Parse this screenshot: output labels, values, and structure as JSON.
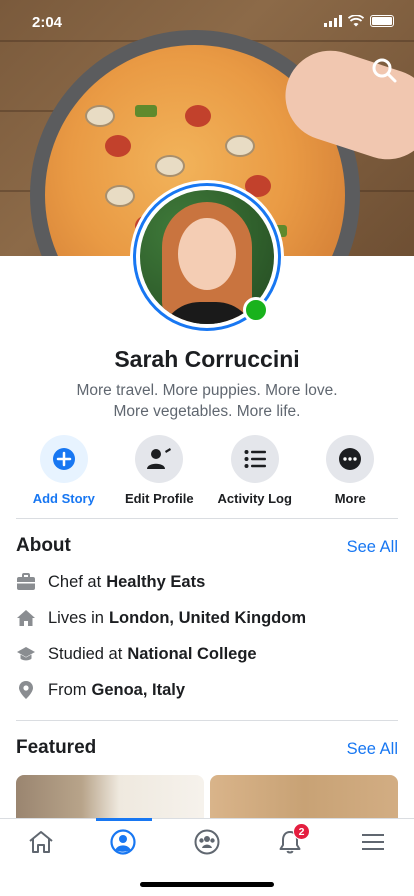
{
  "status_bar": {
    "time": "2:04"
  },
  "profile": {
    "name": "Sarah Corruccini",
    "bio_line1": "More travel. More puppies. More love.",
    "bio_line2": "More vegetables. More life."
  },
  "actions": [
    {
      "label": "Add Story",
      "icon": "plus-circle-icon"
    },
    {
      "label": "Edit Profile",
      "icon": "edit-profile-icon"
    },
    {
      "label": "Activity Log",
      "icon": "list-icon"
    },
    {
      "label": "More",
      "icon": "more-icon"
    }
  ],
  "about": {
    "title": "About",
    "see_all": "See All",
    "items": [
      {
        "prefix": "Chef at",
        "value": "Healthy Eats",
        "icon": "briefcase-icon"
      },
      {
        "prefix": "Lives in",
        "value": "London, United Kingdom",
        "icon": "home-icon"
      },
      {
        "prefix": "Studied at",
        "value": "National College",
        "icon": "graduation-cap-icon"
      },
      {
        "prefix": "From",
        "value": "Genoa, Italy",
        "icon": "location-pin-icon"
      }
    ]
  },
  "featured": {
    "title": "Featured",
    "see_all": "See All"
  },
  "tabbar": {
    "items": [
      "home-icon",
      "profile-icon",
      "groups-icon",
      "notifications-icon",
      "menu-icon"
    ],
    "notifications_badge": "2"
  },
  "colors": {
    "accent": "#1877f2",
    "online": "#19b21c",
    "badge": "#e41e3f"
  }
}
